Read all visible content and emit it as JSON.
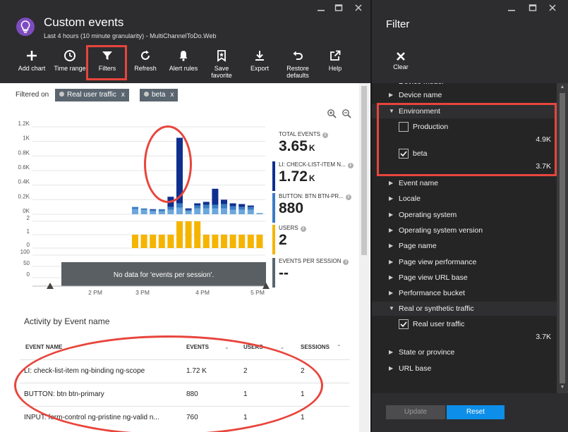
{
  "blade": {
    "title": "Custom events",
    "subtitle": "Last 4 hours (10 minute granularity) - MultiChannelToDo.Web"
  },
  "window_controls": [
    "pin-icon",
    "maximize-icon",
    "close-icon"
  ],
  "toolbar": [
    {
      "label": "Add chart",
      "icon": "plus-icon"
    },
    {
      "label": "Time range",
      "icon": "clock-icon"
    },
    {
      "label": "Filters",
      "icon": "funnel-icon"
    },
    {
      "label": "Refresh",
      "icon": "refresh-icon"
    },
    {
      "label": "Alert rules",
      "icon": "bell-icon"
    },
    {
      "label": "Save favorite",
      "icon": "bookmark-icon"
    },
    {
      "label": "Export",
      "icon": "download-icon"
    },
    {
      "label": "Restore defaults",
      "icon": "undo-icon"
    },
    {
      "label": "Help",
      "icon": "external-link-icon"
    }
  ],
  "filtered_on": {
    "label": "Filtered on",
    "chips": [
      {
        "text": "Real user traffic",
        "close": "x"
      },
      {
        "text": "beta",
        "close": "x"
      }
    ]
  },
  "chart_data": {
    "type": "bar",
    "panels": [
      {
        "name": "events",
        "ylim": [
          0,
          1200
        ],
        "yticks": [
          "0K",
          "0.2K",
          "0.4K",
          "0.6K",
          "0.8K",
          "1K",
          "1.2K"
        ],
        "stacked_series_colors": [
          "#6ba7dd",
          "#3a7cc4",
          "#0f2f8f"
        ],
        "bars": [
          [
            70,
            30,
            0
          ],
          [
            60,
            20,
            0
          ],
          [
            40,
            20,
            10
          ],
          [
            40,
            30,
            0
          ],
          [
            60,
            40,
            140
          ],
          [
            90,
            60,
            900
          ],
          [
            40,
            20,
            20
          ],
          [
            80,
            40,
            30
          ],
          [
            80,
            50,
            40
          ],
          [
            80,
            50,
            220
          ],
          [
            80,
            60,
            60
          ],
          [
            60,
            50,
            40
          ],
          [
            60,
            40,
            40
          ],
          [
            60,
            40,
            20
          ],
          [
            10,
            5,
            0
          ]
        ]
      },
      {
        "name": "users",
        "ylim": [
          0,
          2
        ],
        "yticks": [
          "0",
          "1",
          "2"
        ],
        "color": "#f5b400",
        "values": [
          1,
          1,
          1,
          1,
          1,
          2,
          2,
          2,
          1,
          1,
          1,
          1,
          1,
          1,
          1
        ]
      },
      {
        "name": "events per session",
        "ylim": [
          0,
          100
        ],
        "yticks": [
          "0",
          "50",
          "100"
        ],
        "no_data_message": "No data for 'events per session'."
      }
    ],
    "xticks": [
      "2 PM",
      "3 PM",
      "4 PM",
      "5 PM"
    ]
  },
  "metrics": [
    {
      "label": "TOTAL EVENTS",
      "value": "3.65",
      "unit": "K",
      "color": "",
      "info": true
    },
    {
      "label": "LI: CHECK-LIST-ITEM N...",
      "value": "1.72",
      "unit": "K",
      "color": "#0f2f8f",
      "info": true
    },
    {
      "label": "BUTTON: BTN BTN-PR...",
      "value": "880",
      "unit": "",
      "color": "#3a7cc4",
      "info": true
    },
    {
      "label": "USERS",
      "value": "2",
      "unit": "",
      "color": "#f5b400",
      "info": true
    },
    {
      "label": "EVENTS PER SESSION",
      "value": "--",
      "unit": "",
      "color": "#5a6570",
      "info": true
    }
  ],
  "activity": {
    "title": "Activity by Event name",
    "columns": [
      "EVENT NAME",
      "EVENTS",
      "USERS",
      "SESSIONS"
    ],
    "rows": [
      {
        "name": "LI: check-list-item ng-binding ng-scope",
        "events": "1.72 K",
        "users": "2",
        "sessions": "2"
      },
      {
        "name": "BUTTON: btn btn-primary",
        "events": "880",
        "users": "1",
        "sessions": "1"
      },
      {
        "name": "INPUT: form-control ng-pristine ng-valid n...",
        "events": "760",
        "users": "1",
        "sessions": "1"
      }
    ]
  },
  "filter": {
    "title": "Filter",
    "clear_label": "Clear",
    "partial_top": "Device model",
    "items_top": [
      "Device name"
    ],
    "environment": {
      "label": "Environment",
      "options": [
        {
          "label": "Production",
          "checked": false,
          "count": "4.9K"
        },
        {
          "label": "beta",
          "checked": true,
          "count": "3.7K"
        }
      ]
    },
    "items_mid": [
      "Event name",
      "Locale",
      "Operating system",
      "Operating system version",
      "Page name",
      "Page view performance",
      "Page view URL base",
      "Performance bucket"
    ],
    "traffic": {
      "label": "Real or synthetic traffic",
      "options": [
        {
          "label": "Real user traffic",
          "checked": true,
          "count": "3.7K"
        }
      ]
    },
    "items_bottom": [
      "State or province",
      "URL base"
    ],
    "update_label": "Update",
    "reset_label": "Reset"
  },
  "colors": {
    "header_bg": "#2d2d30",
    "accent": "#0d8ee8",
    "annotation": "#e8453c"
  }
}
